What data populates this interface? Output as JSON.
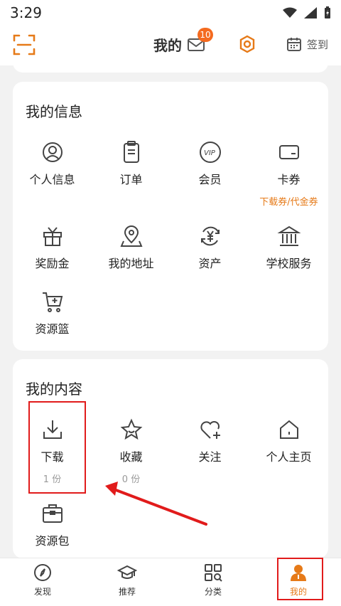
{
  "status": {
    "time": "3:29"
  },
  "header": {
    "title": "我的",
    "mail_badge": "10",
    "checkin_label": "签到"
  },
  "colors": {
    "accent": "#e67a18",
    "badge": "#f46a1f",
    "annotation": "#e11b1b"
  },
  "my_info": {
    "title": "我的信息",
    "items": [
      {
        "label": "个人信息",
        "icon": "person-icon"
      },
      {
        "label": "订单",
        "icon": "clipboard-icon"
      },
      {
        "label": "会员",
        "icon": "vip-icon"
      },
      {
        "label": "卡券",
        "icon": "card-icon",
        "sub": "下载券/代金券"
      },
      {
        "label": "奖励金",
        "icon": "gift-icon"
      },
      {
        "label": "我的地址",
        "icon": "location-icon"
      },
      {
        "label": "资产",
        "icon": "yen-icon"
      },
      {
        "label": "学校服务",
        "icon": "school-icon"
      },
      {
        "label": "资源篮",
        "icon": "cart-icon"
      }
    ]
  },
  "my_content": {
    "title": "我的内容",
    "items": [
      {
        "label": "下载",
        "icon": "download-icon",
        "sub": "1 份"
      },
      {
        "label": "收藏",
        "icon": "star-icon",
        "sub": "0 份"
      },
      {
        "label": "关注",
        "icon": "heart-plus-icon"
      },
      {
        "label": "个人主页",
        "icon": "home-icon"
      },
      {
        "label": "资源包",
        "icon": "briefcase-icon"
      }
    ]
  },
  "bottom_nav": [
    {
      "label": "发现",
      "icon": "compass-icon"
    },
    {
      "label": "推荐",
      "icon": "graduation-cap-icon"
    },
    {
      "label": "分类",
      "icon": "grid-search-icon"
    },
    {
      "label": "我的",
      "icon": "profile-icon",
      "active": true
    }
  ]
}
